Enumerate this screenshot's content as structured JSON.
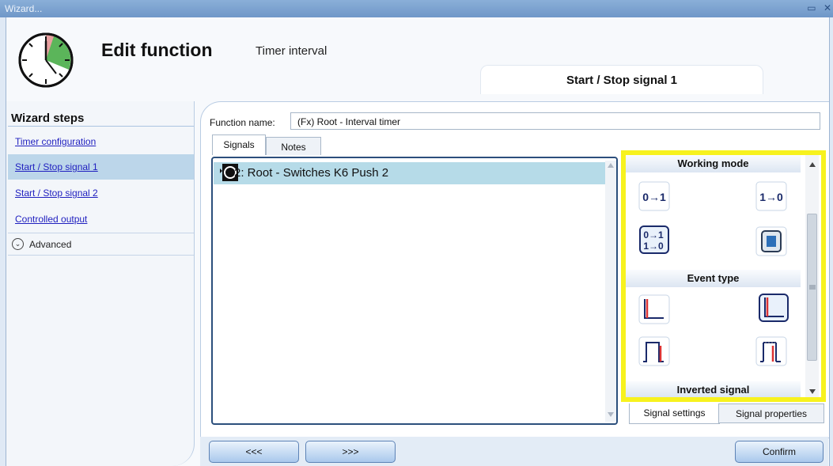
{
  "window": {
    "title": "Wizard...",
    "restore_glyph": "▭",
    "close_glyph": "✕"
  },
  "header": {
    "title": "Edit function",
    "subtitle": "Timer interval",
    "active_step_tab": "Start / Stop signal 1",
    "logo_icon": "timer-clock-icon"
  },
  "wizard_steps": {
    "title": "Wizard steps",
    "items": [
      {
        "label": "Timer configuration",
        "selected": false
      },
      {
        "label": "Start / Stop signal 1",
        "selected": true
      },
      {
        "label": "Start / Stop signal 2",
        "selected": false
      },
      {
        "label": "Controlled output",
        "selected": false
      }
    ],
    "advanced_label": "Advanced",
    "advanced_icon": "chevron-down-circle-icon"
  },
  "function_name": {
    "label": "Function name:",
    "value": "(Fx) Root - Interval timer"
  },
  "tabs": [
    {
      "label": "Signals",
      "active": true
    },
    {
      "label": "Notes",
      "active": false
    }
  ],
  "signals": [
    {
      "label": "2: Root - Switches K6 Push 2",
      "icon": "push-button-icon"
    }
  ],
  "properties_panel": {
    "highlight_color": "#f7f21e",
    "sections": [
      {
        "title": "Working mode",
        "buttons": [
          "0→1",
          "1→0",
          "0→1 1→0",
          "toggle-switch-icon"
        ]
      },
      {
        "title": "Event type",
        "buttons": [
          "rising-edge-icon",
          "falling-edge-icon",
          "pulse-icon",
          "pulse-end-icon"
        ]
      },
      {
        "title": "Inverted signal"
      }
    ],
    "bottom_tabs": [
      {
        "label": "Signal settings",
        "active": true
      },
      {
        "label": "Signal properties",
        "active": false
      }
    ]
  },
  "footer": {
    "prev_label": "<<<",
    "next_label": ">>>",
    "confirm_label": "Confirm"
  }
}
